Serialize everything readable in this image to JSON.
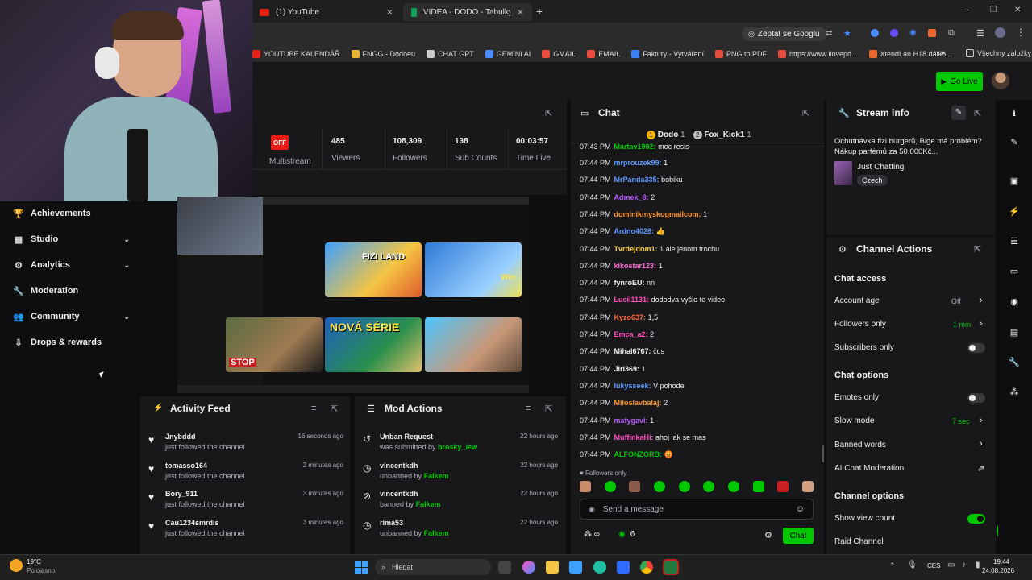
{
  "browser": {
    "tabs": [
      {
        "label": "(1) YouTube"
      },
      {
        "label": "VIDEA - DODO - Tabulky Googl"
      }
    ],
    "address": {
      "google_label": "Zeptat se Googlu"
    },
    "bookmarks": [
      {
        "label": "YOUTUBE KALENDÁŘ",
        "color": "#e62117"
      },
      {
        "label": "FNGG - Dodoeu",
        "color": "#e8b339"
      },
      {
        "label": "CHAT GPT",
        "color": "#cccccc"
      },
      {
        "label": "GEMINI AI",
        "color": "#4a8cff"
      },
      {
        "label": "GMAIL",
        "color": "#e84c3d"
      },
      {
        "label": "EMAIL",
        "color": "#e84c3d"
      },
      {
        "label": "Faktury - Vytváření",
        "color": "#3b82f6"
      },
      {
        "label": "PNG to PDF",
        "color": "#e84c3d"
      },
      {
        "label": "https://www.ilovepd...",
        "color": "#e84c3d"
      },
      {
        "label": "XtendLan H18 dálko...",
        "color": "#e8672e"
      }
    ],
    "bookmarks_more": "»",
    "all_bookmarks": "Všechny záložky",
    "window_controls": [
      "–",
      "❐",
      "✕"
    ]
  },
  "topnav": {
    "go_live_label": "Go Live"
  },
  "sidebar": {
    "items": [
      {
        "label": "Achievements",
        "icon": "trophy-icon",
        "glyph": "🏆",
        "chevron": false
      },
      {
        "label": "Studio",
        "icon": "studio-icon",
        "glyph": "▦",
        "chevron": true
      },
      {
        "label": "Analytics",
        "icon": "analytics-icon",
        "glyph": "⚙",
        "chevron": true
      },
      {
        "label": "Moderation",
        "icon": "wrench-icon",
        "glyph": "🔧",
        "chevron": false
      },
      {
        "label": "Community",
        "icon": "community-icon",
        "glyph": "👥",
        "chevron": true
      },
      {
        "label": "Drops & rewards",
        "icon": "drops-icon",
        "glyph": "⇩",
        "chevron": false
      }
    ]
  },
  "stats": {
    "off_badge": "OFF",
    "multistream": "Multistream",
    "items": [
      {
        "value": "485",
        "label": "Viewers"
      },
      {
        "value": "108,309",
        "label": "Followers"
      },
      {
        "value": "138",
        "label": "Sub Counts"
      },
      {
        "value": "00:03:57",
        "label": "Time Live"
      }
    ]
  },
  "preview": {
    "thumb_texts": [
      "FIZI LAND",
      "NOVÁ SÉRIE",
      "STOP",
      "Win"
    ]
  },
  "activity_feed": {
    "title": "Activity Feed",
    "rows": [
      {
        "name": "Jnybddd",
        "sub": "just followed the channel",
        "time": "16 seconds ago"
      },
      {
        "name": "tomasso164",
        "sub": "just followed the channel",
        "time": "2 minutes ago"
      },
      {
        "name": "Bory_911",
        "sub": "just followed the channel",
        "time": "3 minutes ago"
      },
      {
        "name": "Cau1234smrdis",
        "sub": "just followed the channel",
        "time": "3 minutes ago"
      }
    ]
  },
  "mod_actions": {
    "title": "Mod Actions",
    "rows": [
      {
        "name": "Unban Request",
        "sub_prefix": "was submitted by",
        "by": "brosky_lew",
        "time": "22 hours ago",
        "icon": "unban-request-icon",
        "glyph": "↺"
      },
      {
        "name": "vincentkdh",
        "sub_prefix": "unbanned by",
        "by": "Falkem",
        "time": "22 hours ago",
        "icon": "timer-icon",
        "glyph": "◷"
      },
      {
        "name": "vincentkdh",
        "sub_prefix": "banned by",
        "by": "Falkem",
        "time": "22 hours ago",
        "icon": "ban-icon",
        "glyph": "⊘"
      },
      {
        "name": "rima53",
        "sub_prefix": "unbanned by",
        "by": "Falkem",
        "time": "22 hours ago",
        "icon": "timer-icon",
        "glyph": "◷"
      }
    ]
  },
  "chat": {
    "title": "Chat",
    "top_chatters": [
      {
        "rank": "1",
        "name": "Dodo",
        "count": "1"
      },
      {
        "rank": "2",
        "name": "Fox_Kick1",
        "count": "1"
      }
    ],
    "messages": [
      {
        "time": "07:43 PM",
        "user": "Martav1992:",
        "text": "moc resis",
        "color": "#00c800"
      },
      {
        "time": "07:44 PM",
        "user": "mrprouzek99:",
        "text": "1",
        "color": "#5b9bff"
      },
      {
        "time": "07:44 PM",
        "user": "MrPanda335:",
        "text": "bobiku",
        "color": "#5b9bff"
      },
      {
        "time": "07:44 PM",
        "user": "Admek_8:",
        "text": "2",
        "color": "#b95cff"
      },
      {
        "time": "07:44 PM",
        "user": "dominikmyskogmailcom:",
        "text": "1",
        "color": "#ff9a2e"
      },
      {
        "time": "07:44 PM",
        "user": "Ardno4028:",
        "text": "👍",
        "color": "#5b9bff"
      },
      {
        "time": "07:44 PM",
        "user": "Tvrdejdom1:",
        "text": "1 ale jenom trochu",
        "color": "#ffd23f"
      },
      {
        "time": "07:44 PM",
        "user": "kikostar123:",
        "text": "1",
        "color": "#ff6bd6"
      },
      {
        "time": "07:44 PM",
        "user": "fynroEU:",
        "text": "nn",
        "color": "#efeff1"
      },
      {
        "time": "07:44 PM",
        "user": "Lucii1131:",
        "text": "dododva vyšlo to video",
        "color": "#ff4fbe"
      },
      {
        "time": "07:44 PM",
        "user": "Kyzo637:",
        "text": "1,5",
        "color": "#ff6a3d"
      },
      {
        "time": "07:44 PM",
        "user": "Emca_a2:",
        "text": "2",
        "color": "#ff4fbe"
      },
      {
        "time": "07:44 PM",
        "user": "Mihal6767:",
        "text": "čus",
        "color": "#efeff1"
      },
      {
        "time": "07:44 PM",
        "user": "Jiri369:",
        "text": "1",
        "color": "#efeff1"
      },
      {
        "time": "07:44 PM",
        "user": "lukysseek:",
        "text": "V pohode",
        "color": "#5b9bff"
      },
      {
        "time": "07:44 PM",
        "user": "Miloslavbalaj:",
        "text": "2",
        "color": "#ff9a2e"
      },
      {
        "time": "07:44 PM",
        "user": "matygavi:",
        "text": "1",
        "color": "#b95cff"
      },
      {
        "time": "07:44 PM",
        "user": "MuffinkaHi:",
        "text": "ahoj jak se mas",
        "color": "#ff4fbe"
      },
      {
        "time": "07:44 PM",
        "user": "ALFONZORB:",
        "text": "😡",
        "color": "#00c800"
      }
    ],
    "followers_only": "Followers only",
    "input_placeholder": "Send a message",
    "viewer_count": "6",
    "chat_button": "Chat"
  },
  "stream_info": {
    "title": "Stream info",
    "stream_title": "Ochutnávka fizi burgerů, Bige má problém? Nákup parfémů za 50,000Kč...",
    "category": "Just Chatting",
    "language": "Czech"
  },
  "channel_actions": {
    "title": "Channel Actions",
    "chat_access": {
      "heading": "Chat access",
      "account_age": {
        "label": "Account age",
        "value": "Off"
      },
      "followers_only": {
        "label": "Followers only",
        "value": "1 min"
      },
      "subscribers_only": {
        "label": "Subscribers only"
      }
    },
    "chat_options": {
      "heading": "Chat options",
      "emotes_only": {
        "label": "Emotes only"
      },
      "slow_mode": {
        "label": "Slow mode",
        "value": "7 sec"
      },
      "banned_words": {
        "label": "Banned words"
      },
      "ai_moderation": {
        "label": "AI Chat Moderation"
      }
    },
    "channel_options": {
      "heading": "Channel options",
      "show_view_count": {
        "label": "Show view count"
      },
      "raid_channel": {
        "label": "Raid Channel"
      }
    }
  },
  "taskbar": {
    "weather_temp": "19°C",
    "weather_desc": "Polojasno",
    "search_placeholder": "Hledat",
    "lang": "CES",
    "time": "19:44",
    "date": "24.08.2026"
  },
  "colors": {
    "accent": "#00c800",
    "bg": "#0e0e10",
    "panel": "#18181b"
  }
}
